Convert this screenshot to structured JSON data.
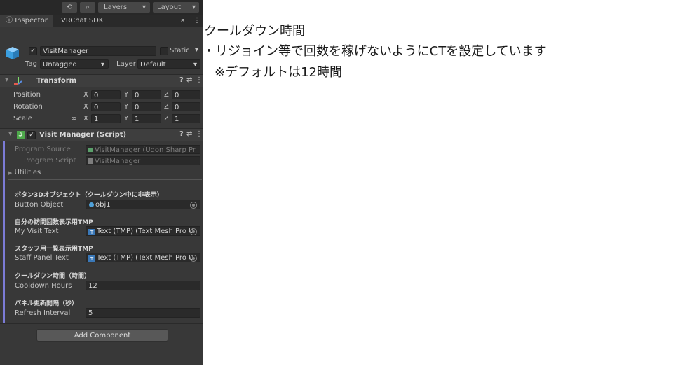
{
  "toolbar": {
    "history_glyph": "⟲",
    "search_glyph": "⌕",
    "layers_label": "Layers",
    "layout_label": "Layout",
    "menu_glyph": "⋮",
    "dropdown_glyph": "▾"
  },
  "tabs": [
    {
      "icon": "ⓘ",
      "label": "Inspector"
    },
    {
      "label": "VRChat SDK"
    }
  ],
  "tab_lock_glyph": "🔓",
  "object": {
    "name": "VisitManager",
    "static_label": "Static",
    "tag_label": "Tag",
    "tag_value": "Untagged",
    "layer_label": "Layer",
    "layer_value": "Default"
  },
  "transform": {
    "title": "Transform",
    "position_label": "Position",
    "rotation_label": "Rotation",
    "scale_label": "Scale",
    "x": "X",
    "y": "Y",
    "z": "Z",
    "position": [
      "0",
      "0",
      "0"
    ],
    "rotation": [
      "0",
      "0",
      "0"
    ],
    "scale": [
      "1",
      "1",
      "1"
    ],
    "link_glyph": "∞"
  },
  "header_icons": {
    "help": "?",
    "settings": "⇄",
    "more": "⋮",
    "fold": "▼"
  },
  "script": {
    "title": "Visit Manager (Script)",
    "program_source_label": "Program Source",
    "program_source_value": "VisitManager (Udon Sharp Pr",
    "program_script_label": "Program Script",
    "program_script_value": "VisitManager",
    "utilities_label": "Utilities",
    "sections": [
      {
        "header": "ボタン3Dオブジェクト（クールダウン中に非表示）",
        "label": "Button Object",
        "value": "obj1"
      },
      {
        "header": "自分の訪問回数表示用TMP",
        "label": "My Visit Text",
        "value": "Text (TMP) (Text Mesh Pro U"
      },
      {
        "header": "スタッフ用一覧表示用TMP",
        "label": "Staff Panel Text",
        "value": "Text (TMP) (Text Mesh Pro U"
      },
      {
        "header": "クールダウン時間（時間）",
        "label": "Cooldown Hours",
        "value": "12"
      },
      {
        "header": "パネル更新間隔（秒）",
        "label": "Refresh Interval",
        "value": "5"
      }
    ],
    "tmp_icon": "T"
  },
  "add_component_label": "Add Component",
  "notes": {
    "line1": "クールダウン時間",
    "line2": "・リジョイン等で回数を稼げないようにCTを設定しています",
    "line3": "※デフォルトは12時間"
  },
  "colors": {
    "panel": "#383838",
    "accent": "#7b7bd6",
    "tmp_blue": "#3a78b8"
  }
}
